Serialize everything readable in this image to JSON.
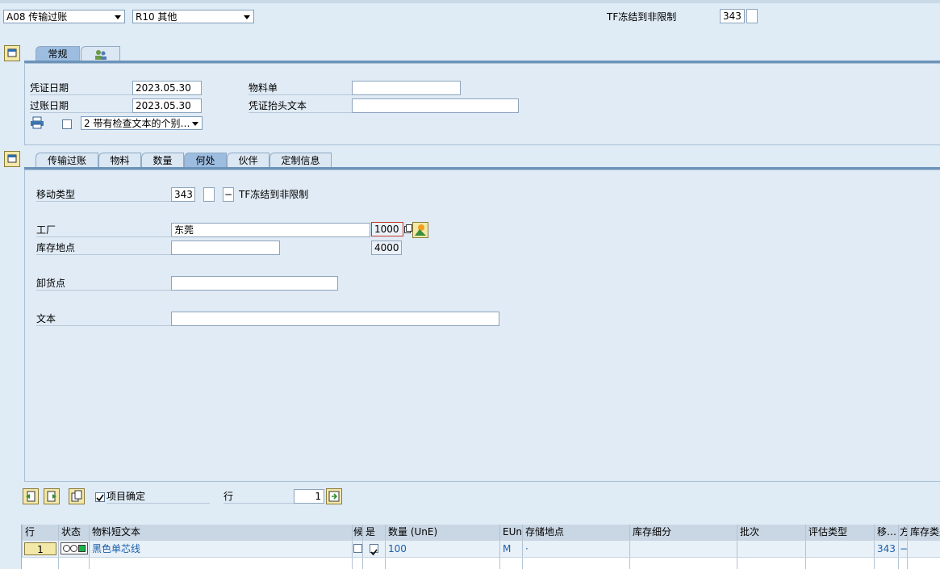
{
  "header": {
    "action_select": "A08 传输过账",
    "reference_select": "R10 其他",
    "movement_desc": "TF冻结到非限制",
    "movement_code": "343"
  },
  "header_tabs": {
    "general": "常规"
  },
  "header_fields": {
    "doc_date_label": "凭证日期",
    "doc_date_value": "2023.05.30",
    "post_date_label": "过账日期",
    "post_date_value": "2023.05.30",
    "material_slip_label": "物料单",
    "material_slip_value": "",
    "header_text_label": "凭证抬头文本",
    "header_text_value": "",
    "print_option": "2 带有检查文本的个别…"
  },
  "detail_tabs": {
    "tab1": "传输过账",
    "tab2": "物料",
    "tab3": "数量",
    "tab4": "何处",
    "tab5": "伙伴",
    "tab6": "定制信息"
  },
  "where_tab": {
    "movement_type_label": "移动类型",
    "movement_type_value": "343",
    "movement_type_sign": "−",
    "movement_type_text": "TF冻结到非限制",
    "plant_label": "工厂",
    "plant_name": "东莞",
    "plant_code": "1000",
    "storage_label": "库存地点",
    "storage_value": "",
    "storage_code": "4000",
    "unloading_label": "卸货点",
    "unloading_value": "",
    "text_label": "文本",
    "text_value": ""
  },
  "item_controls": {
    "item_ok_label": "项目确定",
    "row_label": "行",
    "row_value": "1"
  },
  "table": {
    "columns": [
      "行",
      "状态",
      "物料短文本",
      "候",
      "是",
      "数量 (UnE)",
      "EUn",
      "存储地点",
      "库存细分",
      "批次",
      "评估类型",
      "移…",
      "方",
      "库存类别"
    ],
    "rows": [
      {
        "line": "1",
        "material_text": "黑色单芯线",
        "qty": "100",
        "unit": "M",
        "storage_loc": "·",
        "movement": "343",
        "sign": "−"
      }
    ]
  },
  "colors": {
    "background": "#dfebf5",
    "tab_active": "#9cbde0",
    "accent_blue": "#1a5fa8",
    "error_red": "#c0392b"
  }
}
